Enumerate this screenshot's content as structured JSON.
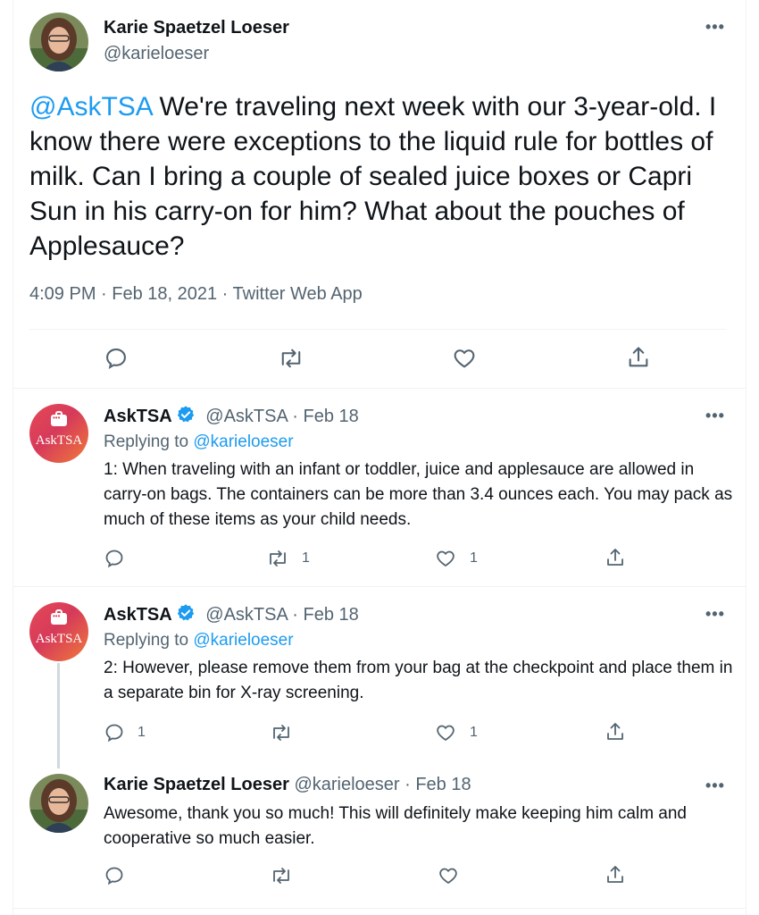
{
  "main_tweet": {
    "author_name": "Karie Spaetzel Loeser",
    "author_handle": "@karieloeser",
    "mention": "@AskTSA",
    "text": " We're traveling next week with our 3-year-old. I know there were exceptions to the liquid rule for bottles of milk. Can I bring a couple of sealed juice boxes or Capri Sun in his carry-on for him? What about the pouches of Applesauce?",
    "meta": "4:09 PM · Feb 18, 2021 · Twitter Web App",
    "more_icon": "more-icon"
  },
  "replies": [
    {
      "author_name": "AskTSA",
      "author_handle": "@AskTSA",
      "date": "· Feb 18",
      "replying_prefix": "Replying to ",
      "replying_to": "@karieloeser",
      "text": "1: When traveling with an infant or toddler, juice and applesauce are allowed in carry-on bags. The containers can be more than 3.4 ounces each. You may pack as much of these items as your child needs.",
      "reply_count": "",
      "retweet_count": "1",
      "like_count": "1",
      "avatar_text": "AskTSA"
    },
    {
      "author_name": "AskTSA",
      "author_handle": "@AskTSA",
      "date": "· Feb 18",
      "replying_prefix": "Replying to ",
      "replying_to": "@karieloeser",
      "text": "2: However, please remove them from your bag at the checkpoint and place them in a separate bin for X-ray screening.",
      "reply_count": "1",
      "retweet_count": "",
      "like_count": "1",
      "avatar_text": "AskTSA"
    },
    {
      "author_name": "Karie Spaetzel Loeser",
      "author_handle": "@karieloeser",
      "date": "· Feb 18",
      "text": "Awesome, thank you so much! This will definitely make keeping him calm and cooperative so much easier.",
      "reply_count": "",
      "retweet_count": "",
      "like_count": ""
    }
  ],
  "colors": {
    "accent": "#1d9bf0",
    "secondary_text": "#536471",
    "divider": "#eff3f4"
  }
}
